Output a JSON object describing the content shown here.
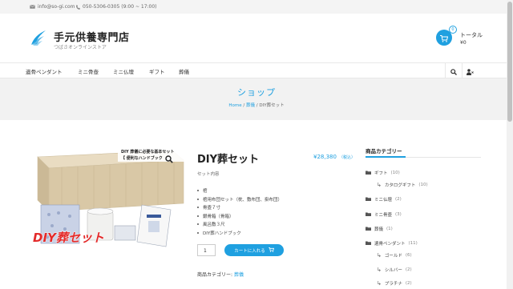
{
  "topbar": {
    "email": "info@so-gi.com",
    "phone": "050-5306-0305 (9:00 ~ 17:00)"
  },
  "header": {
    "site_title": "手元供養専門店",
    "site_subtitle": "つばさオンラインストア",
    "cart_count": "0",
    "total_label": "トータル",
    "total_value": "¥0"
  },
  "nav": {
    "items": [
      "遺骨ペンダント",
      "ミニ骨壺",
      "ミニ仏壇",
      "ギフト",
      "葬儀"
    ]
  },
  "banner": {
    "title": "ショップ",
    "breadcrumb": [
      "Home",
      "葬儀",
      "DIY葬セット"
    ]
  },
  "product": {
    "image_caption_1": "DIY 葬儀に必要な基本セット",
    "image_caption_2": "【 便利なハンドブック",
    "image_overlay": "DIY葬セット",
    "title": "DIY葬セット",
    "price": "¥28,380",
    "tax_note": "（税込）",
    "set_label": "セット内容",
    "specs": [
      "棺",
      "棺用布団セット（枕、敷布団、掛布団）",
      "骨壺７寸",
      "銀骨箱（骨箱）",
      "風呂敷３尺",
      "DIY葬ハンドブック"
    ],
    "quantity": "1",
    "add_to_cart": "カートに入れる",
    "category_label": "商品カテゴリー:",
    "category_value": "葬儀"
  },
  "sidebar": {
    "title": "商品カテゴリー",
    "categories": [
      {
        "label": "ギフト",
        "count": "(10)"
      },
      {
        "label": "カタログギフト",
        "count": "(10)"
      },
      {
        "label": "ミニ仏壇",
        "count": "(2)"
      },
      {
        "label": "ミニ骨壺",
        "count": "(3)"
      },
      {
        "label": "葬儀",
        "count": "(1)"
      },
      {
        "label": "遺骨ペンダント",
        "count": "(11)"
      },
      {
        "label": "ゴールド",
        "count": "(6)"
      },
      {
        "label": "シルバー",
        "count": "(2)"
      },
      {
        "label": "プラチナ",
        "count": "(2)"
      }
    ]
  },
  "colors": {
    "accent": "#1fa0e0",
    "banner_bg": "#f2f2f2"
  }
}
